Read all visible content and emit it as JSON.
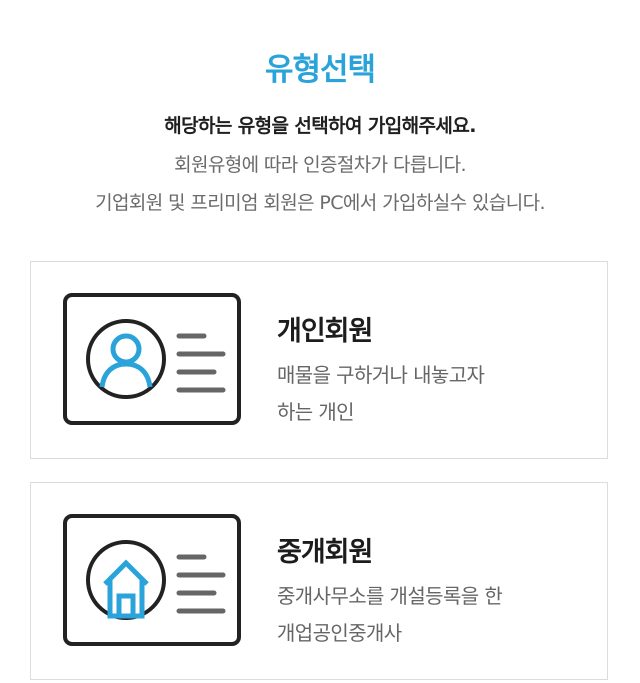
{
  "header": {
    "title": "유형선택",
    "instruction": "해당하는 유형을 선택하여 가입해주세요.",
    "note_line1": "회원유형에 따라 인증절차가 다릅니다.",
    "note_line2": "기업회원 및 프리미엄 회원은 PC에서 가입하실수 있습니다."
  },
  "cards": [
    {
      "title": "개인회원",
      "desc_line1": "매물을 구하거나 내놓고자",
      "desc_line2": "하는 개인",
      "icon": "person-icon"
    },
    {
      "title": "중개회원",
      "desc_line1": "중개사무소를 개설등록을 한",
      "desc_line2": "개업공인중개사",
      "icon": "house-icon"
    }
  ],
  "colors": {
    "accent": "#29a3d9",
    "text_dark": "#1f1f1f",
    "text_gray": "#666666",
    "border": "#dcdcdc"
  }
}
